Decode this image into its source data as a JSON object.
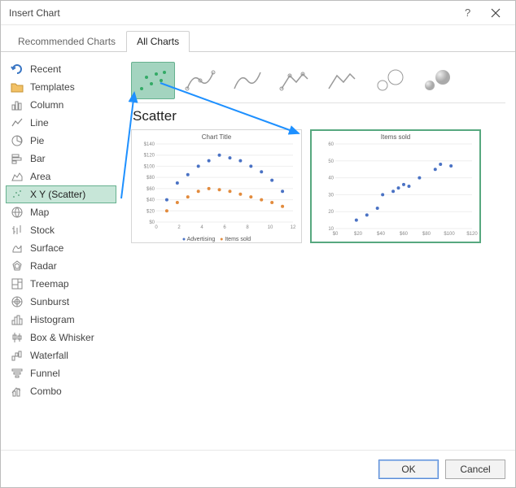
{
  "window": {
    "title": "Insert Chart",
    "help_tooltip": "?",
    "close_tooltip": "×"
  },
  "tabs": {
    "recommended": "Recommended Charts",
    "all": "All Charts"
  },
  "sidebar": {
    "items": [
      {
        "label": "Recent",
        "icon": "recent"
      },
      {
        "label": "Templates",
        "icon": "template"
      },
      {
        "label": "Column",
        "icon": "column"
      },
      {
        "label": "Line",
        "icon": "line"
      },
      {
        "label": "Pie",
        "icon": "pie"
      },
      {
        "label": "Bar",
        "icon": "bar"
      },
      {
        "label": "Area",
        "icon": "area"
      },
      {
        "label": "X Y (Scatter)",
        "icon": "scatter"
      },
      {
        "label": "Map",
        "icon": "map"
      },
      {
        "label": "Stock",
        "icon": "stock"
      },
      {
        "label": "Surface",
        "icon": "surface"
      },
      {
        "label": "Radar",
        "icon": "radar"
      },
      {
        "label": "Treemap",
        "icon": "treemap"
      },
      {
        "label": "Sunburst",
        "icon": "sunburst"
      },
      {
        "label": "Histogram",
        "icon": "histogram"
      },
      {
        "label": "Box & Whisker",
        "icon": "boxwhisker"
      },
      {
        "label": "Waterfall",
        "icon": "waterfall"
      },
      {
        "label": "Funnel",
        "icon": "funnel"
      },
      {
        "label": "Combo",
        "icon": "combo"
      }
    ]
  },
  "main": {
    "section_title": "Scatter",
    "subtypes": [
      "scatter",
      "scatter-smooth-markers",
      "scatter-smooth",
      "scatter-straight-markers",
      "scatter-straight",
      "bubble",
      "bubble-3d"
    ],
    "preview1": {
      "title": "Chart Title",
      "legend": {
        "a": "Advertising",
        "b": "Items sold"
      }
    },
    "preview2": {
      "title": "Items sold"
    }
  },
  "footer": {
    "ok": "OK",
    "cancel": "Cancel"
  },
  "chart_data": [
    {
      "type": "scatter",
      "title": "Chart Title",
      "xlabel": "",
      "ylabel": "",
      "xlim": [
        0,
        13
      ],
      "ylim": [
        0,
        140
      ],
      "x_ticks": [
        0,
        2,
        4,
        6,
        8,
        10,
        12
      ],
      "y_ticks": [
        "$0",
        "$20",
        "$40",
        "$60",
        "$80",
        "$100",
        "$120",
        "$140"
      ],
      "series": [
        {
          "name": "Advertising",
          "color": "#4a72c4",
          "x": [
            1,
            2,
            3,
            4,
            5,
            6,
            7,
            8,
            9,
            10,
            11,
            12
          ],
          "y": [
            40,
            70,
            85,
            100,
            110,
            120,
            115,
            110,
            100,
            90,
            75,
            55
          ]
        },
        {
          "name": "Items sold",
          "color": "#e28b3d",
          "x": [
            1,
            2,
            3,
            4,
            5,
            6,
            7,
            8,
            9,
            10,
            11,
            12
          ],
          "y": [
            20,
            35,
            45,
            55,
            60,
            58,
            55,
            50,
            45,
            40,
            35,
            28
          ]
        }
      ]
    },
    {
      "type": "scatter",
      "title": "Items sold",
      "xlabel": "",
      "ylabel": "",
      "xlim": [
        0,
        130
      ],
      "ylim": [
        10,
        60
      ],
      "x_ticks": [
        "$0",
        "$20",
        "$40",
        "$60",
        "$80",
        "$100",
        "$120"
      ],
      "y_ticks": [
        10,
        20,
        30,
        40,
        50,
        60
      ],
      "series": [
        {
          "name": "Items sold",
          "color": "#4a72c4",
          "x": [
            20,
            30,
            40,
            45,
            55,
            60,
            65,
            70,
            80,
            95,
            100,
            110
          ],
          "y": [
            15,
            18,
            22,
            30,
            32,
            34,
            36,
            35,
            40,
            45,
            48,
            47
          ]
        }
      ]
    }
  ]
}
